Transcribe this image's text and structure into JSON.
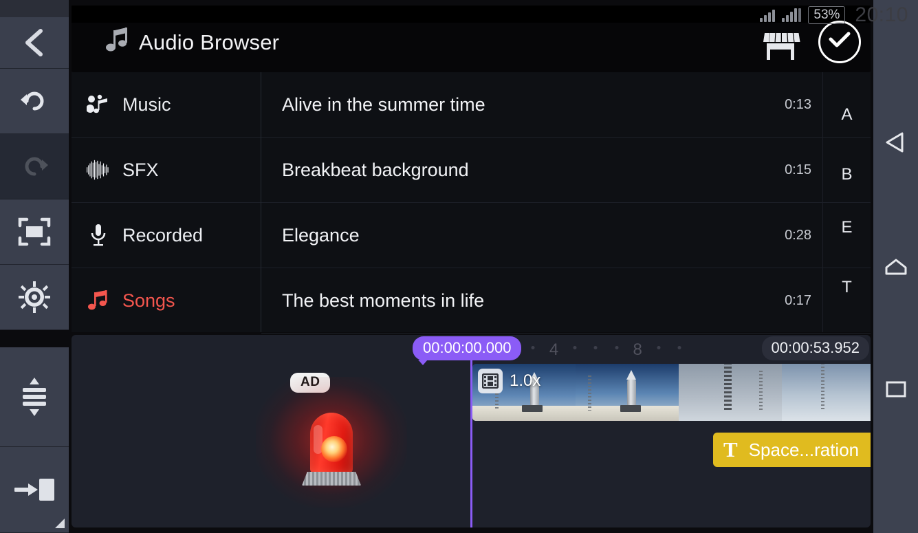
{
  "app": {
    "title": "Audio Browser",
    "title_icon": "music-note-icon",
    "accent_purple": "#8b5cf6",
    "accent_red": "#f4564e",
    "text_clip_color": "#e0bb1f"
  },
  "statusbar": {
    "battery": "53%",
    "time": "20:10",
    "signal_icon": "signal-bars-icon",
    "signal_icon_2": "signal-bars-icon"
  },
  "header": {
    "store_icon": "store-icon",
    "confirm_icon": "check-circle-icon",
    "confirm_label": "Confirm"
  },
  "rail": {
    "items": [
      {
        "name": "back",
        "icon": "chevron-left-icon",
        "enabled": true
      },
      {
        "name": "undo",
        "icon": "undo-icon",
        "enabled": true
      },
      {
        "name": "redo",
        "icon": "redo-icon",
        "enabled": false
      },
      {
        "name": "fit-to-screen",
        "icon": "fit-screen-icon",
        "enabled": true
      },
      {
        "name": "settings",
        "icon": "gear-icon",
        "enabled": true
      },
      {
        "name": "expand-tracks",
        "icon": "expand-tracks-icon",
        "enabled": true
      },
      {
        "name": "add-to-timeline",
        "icon": "insert-clip-icon",
        "enabled": true
      }
    ]
  },
  "browser": {
    "categories": [
      {
        "label": "Music",
        "icon": "music-group-icon",
        "active": false
      },
      {
        "label": "SFX",
        "icon": "waveform-icon",
        "active": false
      },
      {
        "label": "Recorded",
        "icon": "microphone-icon",
        "active": false
      },
      {
        "label": "Songs",
        "icon": "music-note-icon",
        "active": true
      }
    ],
    "tracks": [
      {
        "name": "Alive in the summer time",
        "duration": "0:13",
        "letter": "A"
      },
      {
        "name": "Breakbeat background",
        "duration": "0:15",
        "letter": "B"
      },
      {
        "name": "Elegance",
        "duration": "0:28",
        "letter": "E"
      },
      {
        "name": "The best moments in life",
        "duration": "0:17",
        "letter": "T"
      }
    ]
  },
  "timeline": {
    "playhead_time": "00:00:00.000",
    "total_time": "00:00:53.952",
    "ruler_labels": [
      "4",
      "8"
    ],
    "video_clip": {
      "speed": "1.0x",
      "speed_icon": "film-strip-icon",
      "content": "rocket launch footage"
    },
    "text_clip": {
      "label": "Space...ration",
      "icon": "text-T-icon"
    }
  },
  "ad": {
    "badge": "AD",
    "graphic": "red-siren-beacon"
  },
  "navbar": {
    "items": [
      {
        "name": "android-back",
        "icon": "triangle-back-icon"
      },
      {
        "name": "android-home",
        "icon": "home-pentagon-icon"
      },
      {
        "name": "android-recents",
        "icon": "square-recents-icon"
      }
    ]
  }
}
